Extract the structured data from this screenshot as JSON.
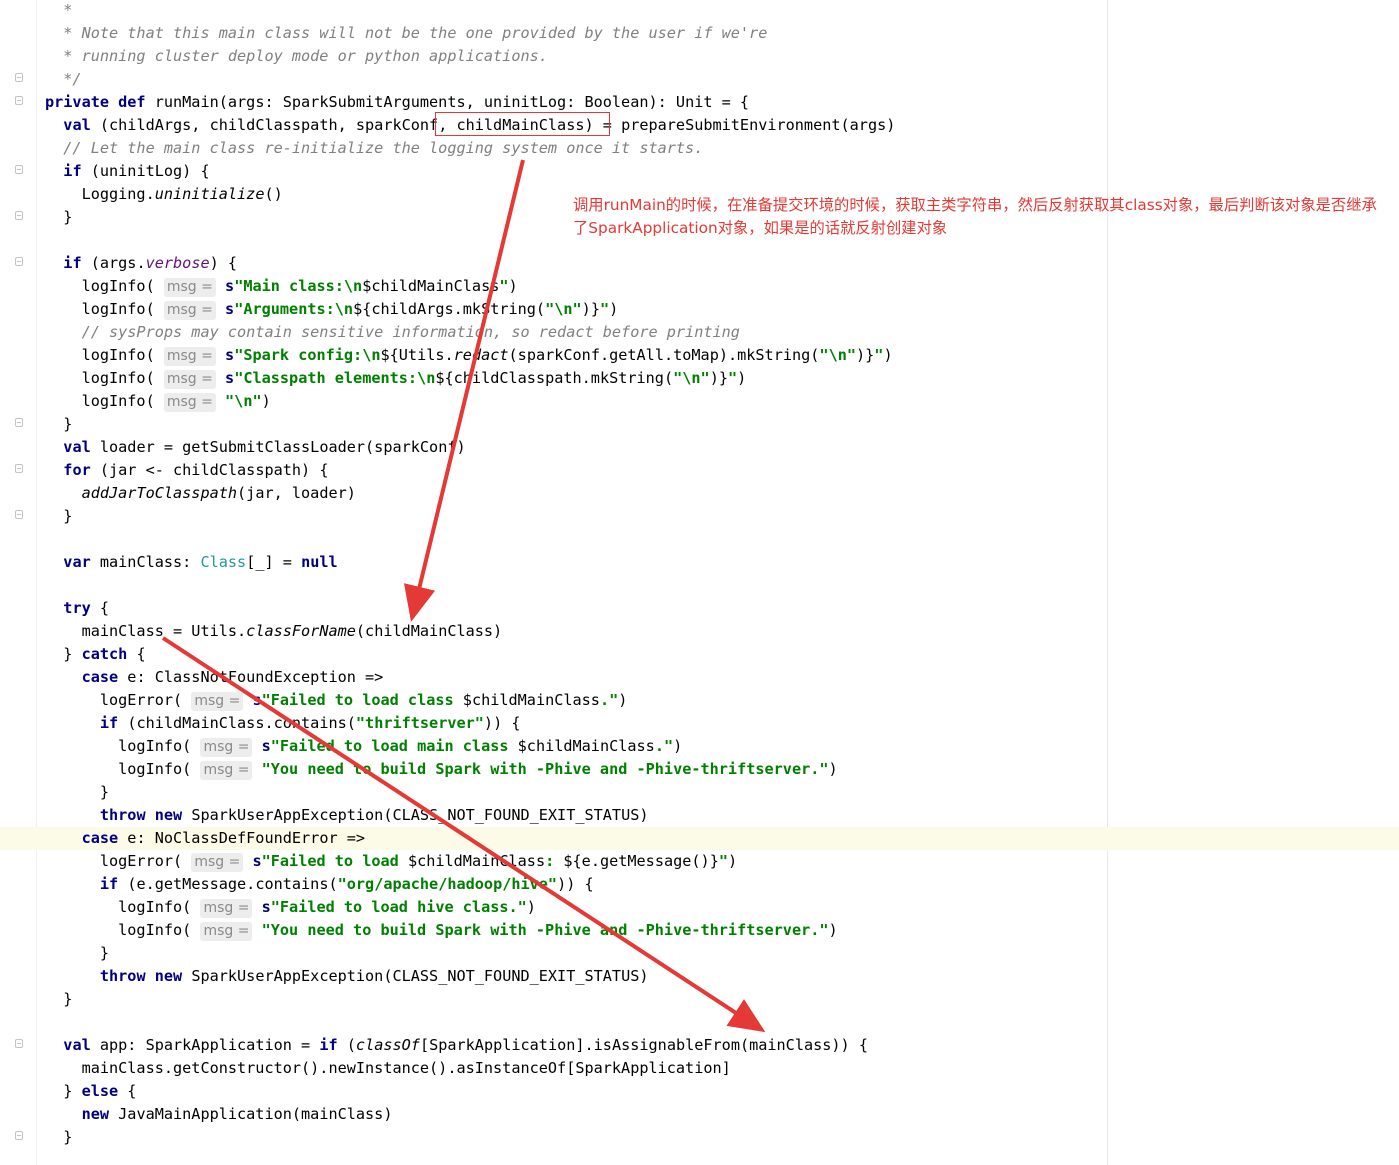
{
  "code_lines": [
    [
      {
        "c": "cm",
        "t": "  *"
      }
    ],
    [
      {
        "c": "cm",
        "t": "  * Note that this main class will not be the one provided by the user if we're"
      }
    ],
    [
      {
        "c": "cm",
        "t": "  * running cluster deploy mode or python applications."
      }
    ],
    [
      {
        "c": "cm",
        "t": "  */"
      }
    ],
    [
      {
        "c": "kw",
        "t": "private def "
      },
      {
        "t": "runMain(args: SparkSubmitArguments, uninitLog: Boolean): Unit = {"
      }
    ],
    [
      {
        "t": "  "
      },
      {
        "c": "kw",
        "t": "val "
      },
      {
        "t": "(childArgs, childClasspath, sparkConf, childMainClass) = prepareSubmitEnvironment(args)"
      }
    ],
    [
      {
        "c": "cm",
        "t": "  // Let the main class re-initialize the logging system once it starts."
      }
    ],
    [
      {
        "t": "  "
      },
      {
        "c": "kw",
        "t": "if "
      },
      {
        "t": "(uninitLog) {"
      }
    ],
    [
      {
        "t": "    Logging."
      },
      {
        "c": "it",
        "t": "uninitialize"
      },
      {
        "t": "()"
      }
    ],
    [
      {
        "t": "  }"
      }
    ],
    [
      {
        "t": ""
      }
    ],
    [
      {
        "t": "  "
      },
      {
        "c": "kw",
        "t": "if "
      },
      {
        "t": "(args."
      },
      {
        "c": "pv",
        "t": "verbose"
      },
      {
        "t": ") {"
      }
    ],
    [
      {
        "t": "    logInfo( "
      },
      {
        "c": "hint",
        "t": "msg ="
      },
      {
        "t": " "
      },
      {
        "c": "kw",
        "t": "s"
      },
      {
        "c": "st",
        "t": "\"Main class:\\n"
      },
      {
        "t": "$childMainClass"
      },
      {
        "c": "st",
        "t": "\""
      },
      {
        "t": ")"
      }
    ],
    [
      {
        "t": "    logInfo( "
      },
      {
        "c": "hint",
        "t": "msg ="
      },
      {
        "t": " "
      },
      {
        "c": "kw",
        "t": "s"
      },
      {
        "c": "st",
        "t": "\"Arguments:\\n"
      },
      {
        "t": "${childArgs.mkString("
      },
      {
        "c": "st",
        "t": "\"\\n\""
      },
      {
        "t": ")}"
      },
      {
        "c": "st",
        "t": "\""
      },
      {
        "t": ")"
      }
    ],
    [
      {
        "c": "cm",
        "t": "    // sysProps may contain sensitive information, so redact before printing"
      }
    ],
    [
      {
        "t": "    logInfo( "
      },
      {
        "c": "hint",
        "t": "msg ="
      },
      {
        "t": " "
      },
      {
        "c": "kw",
        "t": "s"
      },
      {
        "c": "st",
        "t": "\"Spark config:\\n"
      },
      {
        "t": "${Utils."
      },
      {
        "c": "it",
        "t": "redact"
      },
      {
        "t": "(sparkConf.getAll.toMap).mkString("
      },
      {
        "c": "st",
        "t": "\"\\n\""
      },
      {
        "t": ")}"
      },
      {
        "c": "st",
        "t": "\""
      },
      {
        "t": ")"
      }
    ],
    [
      {
        "t": "    logInfo( "
      },
      {
        "c": "hint",
        "t": "msg ="
      },
      {
        "t": " "
      },
      {
        "c": "kw",
        "t": "s"
      },
      {
        "c": "st",
        "t": "\"Classpath elements:\\n"
      },
      {
        "t": "${childClasspath.mkString("
      },
      {
        "c": "st",
        "t": "\"\\n\""
      },
      {
        "t": ")}"
      },
      {
        "c": "st",
        "t": "\""
      },
      {
        "t": ")"
      }
    ],
    [
      {
        "t": "    logInfo( "
      },
      {
        "c": "hint",
        "t": "msg ="
      },
      {
        "t": " "
      },
      {
        "c": "st",
        "t": "\"\\n\""
      },
      {
        "t": ")"
      }
    ],
    [
      {
        "t": "  }"
      }
    ],
    [
      {
        "t": "  "
      },
      {
        "c": "kw",
        "t": "val "
      },
      {
        "t": "loader = getSubmitClassLoader(sparkConf)"
      }
    ],
    [
      {
        "t": "  "
      },
      {
        "c": "kw",
        "t": "for "
      },
      {
        "t": "(jar <- childClasspath) {"
      }
    ],
    [
      {
        "t": "    "
      },
      {
        "c": "it",
        "t": "addJarToClasspath"
      },
      {
        "t": "(jar, loader)"
      }
    ],
    [
      {
        "t": "  }"
      }
    ],
    [
      {
        "t": ""
      }
    ],
    [
      {
        "t": "  "
      },
      {
        "c": "kw",
        "t": "var "
      },
      {
        "t": "mainClass: "
      },
      {
        "c": "ty",
        "t": "Class"
      },
      {
        "t": "[_] = "
      },
      {
        "c": "kw",
        "t": "null"
      }
    ],
    [
      {
        "t": ""
      }
    ],
    [
      {
        "t": "  "
      },
      {
        "c": "kw",
        "t": "try "
      },
      {
        "t": "{"
      }
    ],
    [
      {
        "t": "    mainClass = Utils."
      },
      {
        "c": "it",
        "t": "classForName"
      },
      {
        "t": "(childMainClass)"
      }
    ],
    [
      {
        "t": "  } "
      },
      {
        "c": "kw",
        "t": "catch "
      },
      {
        "t": "{"
      }
    ],
    [
      {
        "t": "    "
      },
      {
        "c": "kw",
        "t": "case "
      },
      {
        "t": "e: ClassNotFoundException =>"
      }
    ],
    [
      {
        "t": "      logError( "
      },
      {
        "c": "hint",
        "t": "msg ="
      },
      {
        "t": " "
      },
      {
        "c": "kw",
        "t": "s"
      },
      {
        "c": "st",
        "t": "\"Failed to load class "
      },
      {
        "t": "$childMainClass"
      },
      {
        "c": "st",
        "t": ".\""
      },
      {
        "t": ")"
      }
    ],
    [
      {
        "t": "      "
      },
      {
        "c": "kw",
        "t": "if "
      },
      {
        "t": "(childMainClass.contains("
      },
      {
        "c": "st",
        "t": "\"thriftserver\""
      },
      {
        "t": ")) {"
      }
    ],
    [
      {
        "t": "        logInfo( "
      },
      {
        "c": "hint",
        "t": "msg ="
      },
      {
        "t": " "
      },
      {
        "c": "kw",
        "t": "s"
      },
      {
        "c": "st",
        "t": "\"Failed to load main class "
      },
      {
        "t": "$childMainClass"
      },
      {
        "c": "st",
        "t": ".\""
      },
      {
        "t": ")"
      }
    ],
    [
      {
        "t": "        logInfo( "
      },
      {
        "c": "hint",
        "t": "msg ="
      },
      {
        "t": " "
      },
      {
        "c": "st",
        "t": "\"You need to build Spark with -Phive and -Phive-thriftserver.\""
      },
      {
        "t": ")"
      }
    ],
    [
      {
        "t": "      }"
      }
    ],
    [
      {
        "t": "      "
      },
      {
        "c": "kw",
        "t": "throw new "
      },
      {
        "t": "SparkUserAppException(CLASS_NOT_FOUND_EXIT_STATUS)"
      }
    ],
    [
      {
        "t": "    "
      },
      {
        "c": "kw",
        "t": "case "
      },
      {
        "t": "e: NoClassDefFoundError =>"
      }
    ],
    [
      {
        "t": "      logError( "
      },
      {
        "c": "hint",
        "t": "msg ="
      },
      {
        "t": " "
      },
      {
        "c": "kw",
        "t": "s"
      },
      {
        "c": "st",
        "t": "\"Failed to load "
      },
      {
        "t": "$childMainClass"
      },
      {
        "c": "st",
        "t": ": "
      },
      {
        "t": "${e.getMessage()}"
      },
      {
        "c": "st",
        "t": "\""
      },
      {
        "t": ")"
      }
    ],
    [
      {
        "t": "      "
      },
      {
        "c": "kw",
        "t": "if "
      },
      {
        "t": "(e.getMessage.contains("
      },
      {
        "c": "st",
        "t": "\"org/apache/hadoop/hive\""
      },
      {
        "t": ")) {"
      }
    ],
    [
      {
        "t": "        logInfo( "
      },
      {
        "c": "hint",
        "t": "msg ="
      },
      {
        "t": " "
      },
      {
        "c": "kw",
        "t": "s"
      },
      {
        "c": "st",
        "t": "\"Failed to load hive class.\""
      },
      {
        "t": ")"
      }
    ],
    [
      {
        "t": "        logInfo( "
      },
      {
        "c": "hint",
        "t": "msg ="
      },
      {
        "t": " "
      },
      {
        "c": "st",
        "t": "\"You need to build Spark with -Phive and -Phive-thriftserver.\""
      },
      {
        "t": ")"
      }
    ],
    [
      {
        "t": "      }"
      }
    ],
    [
      {
        "t": "      "
      },
      {
        "c": "kw",
        "t": "throw new "
      },
      {
        "t": "SparkUserAppException(CLASS_NOT_FOUND_EXIT_STATUS)"
      }
    ],
    [
      {
        "t": "  }"
      }
    ],
    [
      {
        "t": ""
      }
    ],
    [
      {
        "t": "  "
      },
      {
        "c": "kw",
        "t": "val "
      },
      {
        "t": "app: SparkApplication = "
      },
      {
        "c": "kw",
        "t": "if "
      },
      {
        "t": "("
      },
      {
        "c": "it",
        "t": "classOf"
      },
      {
        "t": "[SparkApplication].isAssignableFrom(mainClass)) {"
      }
    ],
    [
      {
        "t": "    mainClass.getConstructor().newInstance().asInstanceOf[SparkApplication]"
      }
    ],
    [
      {
        "t": "  } "
      },
      {
        "c": "kw",
        "t": "else "
      },
      {
        "t": "{"
      }
    ],
    [
      {
        "t": "    "
      },
      {
        "c": "kw",
        "t": "new "
      },
      {
        "t": "JavaMainApplication(mainClass)"
      }
    ],
    [
      {
        "t": "  }"
      }
    ]
  ],
  "annotation": {
    "text": "调用runMain的时候，在准备提交环境的时候，获取主类字符串，然后反射获取其class对象，最后判断该对象是否继承了SparkApplication对象，如果是的话就反射创建对象",
    "color": "#e53935"
  },
  "colors": {
    "keyword": "#000080",
    "comment": "#808080",
    "string": "#008000",
    "type": "#20999d",
    "caret_line": "#fcfbe8"
  }
}
